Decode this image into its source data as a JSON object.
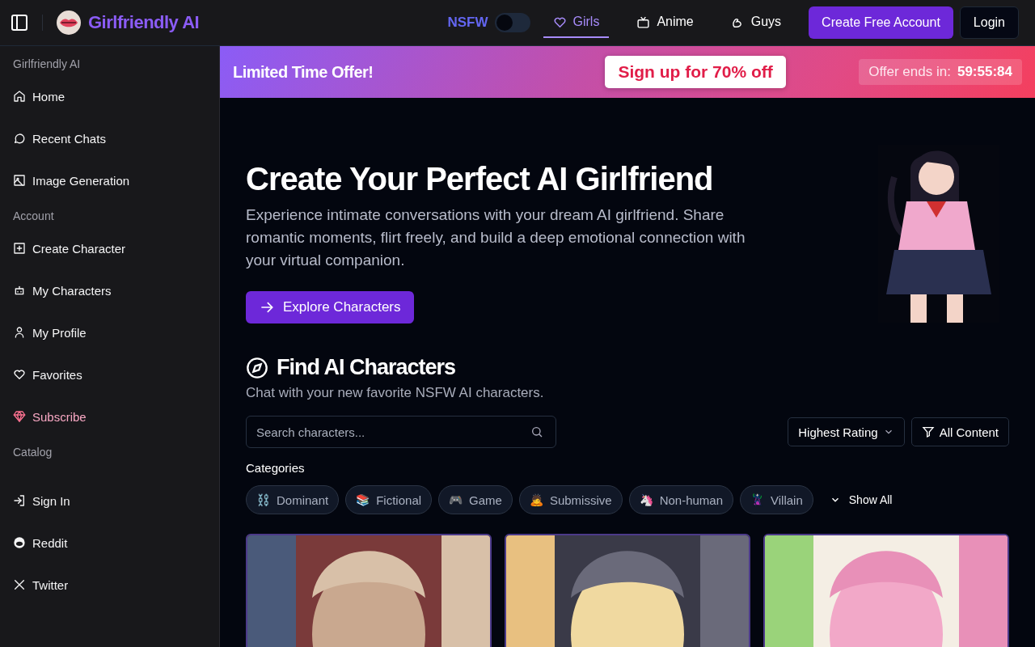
{
  "header": {
    "brand": "Girlfriendly AI",
    "nsfw": {
      "label": "NSFW",
      "on": false
    },
    "tabs": [
      {
        "label": "Girls",
        "selected": true
      },
      {
        "label": "Anime",
        "selected": false
      },
      {
        "label": "Guys",
        "selected": false
      }
    ],
    "signup_button": "Create Free Account",
    "login_button": "Login"
  },
  "sidebar": {
    "sections": [
      {
        "title": "Girlfriendly AI",
        "items": [
          {
            "label": "Home",
            "highlighted": false
          },
          {
            "label": "Recent Chats",
            "highlighted": false
          },
          {
            "label": "Image Generation",
            "highlighted": false
          }
        ]
      },
      {
        "title": "Account",
        "items": [
          {
            "label": "Create Character",
            "highlighted": false
          },
          {
            "label": "My Characters",
            "highlighted": false
          },
          {
            "label": "My Profile",
            "highlighted": false
          },
          {
            "label": "Favorites",
            "highlighted": false
          },
          {
            "label": "Subscribe",
            "highlighted": true
          }
        ]
      },
      {
        "title": "Catalog",
        "items": [
          {
            "label": "Sign In",
            "highlighted": false
          },
          {
            "label": "Reddit",
            "highlighted": false
          },
          {
            "label": "Twitter",
            "highlighted": false
          }
        ]
      }
    ]
  },
  "banner": {
    "title": "Limited Time Offer!",
    "cta": "Sign up for 70% off",
    "countdown_label": "Offer ends in:",
    "countdown": "59:55:84"
  },
  "hero": {
    "title": "Create Your Perfect AI Girlfriend",
    "text": "Experience intimate conversations with your dream AI girlfriend. Share romantic moments, flirt freely, and build a deep emotional connection with your virtual companion.",
    "button": "Explore Characters"
  },
  "finder": {
    "title": "Find AI Characters",
    "subtitle": "Chat with your new favorite NSFW AI characters.",
    "search": {
      "placeholder": "Search characters..."
    },
    "sort": "Highest Rating",
    "filter": "All Content",
    "categories_label": "Categories",
    "categories": [
      {
        "emoji": "⛓️",
        "label": "Dominant"
      },
      {
        "emoji": "📚",
        "label": "Fictional"
      },
      {
        "emoji": "🎮",
        "label": "Game"
      },
      {
        "emoji": "🙇",
        "label": "Submissive"
      },
      {
        "emoji": "🦄",
        "label": "Non-human"
      },
      {
        "emoji": "🦹",
        "label": "Villain"
      }
    ],
    "show_all": "Show All"
  }
}
